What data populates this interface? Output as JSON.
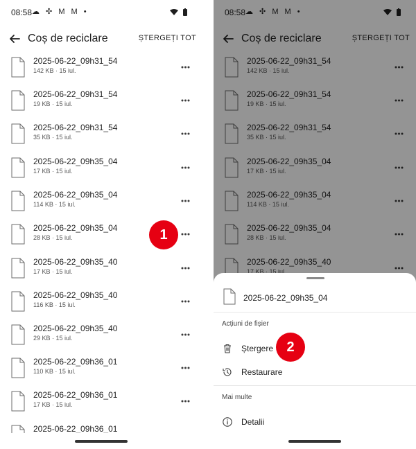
{
  "status_bar": {
    "time": "08:58",
    "icons": "☁ ✣ M M •"
  },
  "app_bar": {
    "title": "Coș de reciclare",
    "clear_all": "ȘTERGEȚI TOT"
  },
  "files": [
    {
      "name": "2025-06-22_09h31_54",
      "meta": "142 KB · 15 iul."
    },
    {
      "name": "2025-06-22_09h31_54",
      "meta": "19 KB · 15 iul."
    },
    {
      "name": "2025-06-22_09h31_54",
      "meta": "35 KB · 15 iul."
    },
    {
      "name": "2025-06-22_09h35_04",
      "meta": "17 KB · 15 iul."
    },
    {
      "name": "2025-06-22_09h35_04",
      "meta": "114 KB · 15 iul."
    },
    {
      "name": "2025-06-22_09h35_04",
      "meta": "28 KB · 15 iul."
    },
    {
      "name": "2025-06-22_09h35_40",
      "meta": "17 KB · 15 iul."
    },
    {
      "name": "2025-06-22_09h35_40",
      "meta": "116 KB · 15 iul."
    },
    {
      "name": "2025-06-22_09h35_40",
      "meta": "29 KB · 15 iul."
    },
    {
      "name": "2025-06-22_09h36_01",
      "meta": "110 KB · 15 iul."
    },
    {
      "name": "2025-06-22_09h36_01",
      "meta": "17 KB · 15 iul."
    },
    {
      "name": "2025-06-22_09h36_01",
      "meta": ""
    }
  ],
  "sheet": {
    "file_name": "2025-06-22_09h35_04",
    "section_actions": "Acțiuni de fișier",
    "delete_label": "Ștergere",
    "restore_label": "Restaurare",
    "section_more": "Mai multe",
    "details_label": "Detalii"
  },
  "badges": {
    "step1": "1",
    "step2": "2"
  },
  "colors": {
    "badge": "#e60012",
    "scrim": "rgba(0,0,0,0.42)",
    "text": "#1f1f1f"
  }
}
